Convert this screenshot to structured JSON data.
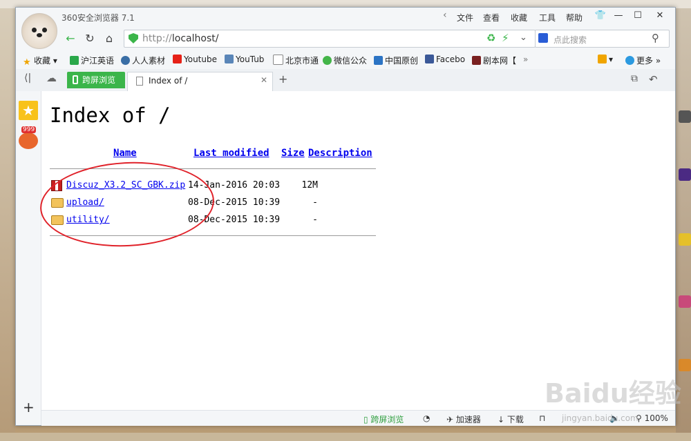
{
  "browser": {
    "app_title": "360安全浏览器 7.1",
    "menu": [
      "文件",
      "查看",
      "收藏",
      "工具",
      "帮助"
    ],
    "url_prefix": "http://",
    "url_host": "localhost/",
    "search_placeholder": "点此搜索"
  },
  "bookmarks": {
    "favorites_label": "收藏",
    "items": [
      "沪江英语",
      "人人素材",
      "Youtube",
      "YouTub",
      "北京市通",
      "微信公众",
      "中国原创",
      "Facebo",
      "剧本网【"
    ],
    "more_label": "更多"
  },
  "tabs": {
    "cross_screen": "跨屏浏览",
    "active": "Index of /"
  },
  "sidebar": {
    "badge": "999"
  },
  "page": {
    "title": "Index of /",
    "columns": {
      "name": "Name",
      "last_modified": "Last modified",
      "size": "Size",
      "description": "Description"
    },
    "files": [
      {
        "icon": "zip-icon",
        "name": "Discuz_X3.2_SC_GBK.zip",
        "date": "14-Jan-2016 20:03",
        "size": "12M"
      },
      {
        "icon": "folder-icon",
        "name": "upload/",
        "date": "08-Dec-2015 10:39",
        "size": "-"
      },
      {
        "icon": "folder-icon",
        "name": "utility/",
        "date": "08-Dec-2015 10:39",
        "size": "-"
      }
    ]
  },
  "statusbar": {
    "cross_screen": "跨屏浏览",
    "accelerator": "加速器",
    "download": "下载",
    "zoom": "100%"
  },
  "watermark": {
    "main": "Baidu经验",
    "sub": "jingyan.baidu.com"
  },
  "colors": {
    "annotation_circle": "#e0222a",
    "accent_green": "#3bb54a",
    "link": "#0000ee"
  }
}
